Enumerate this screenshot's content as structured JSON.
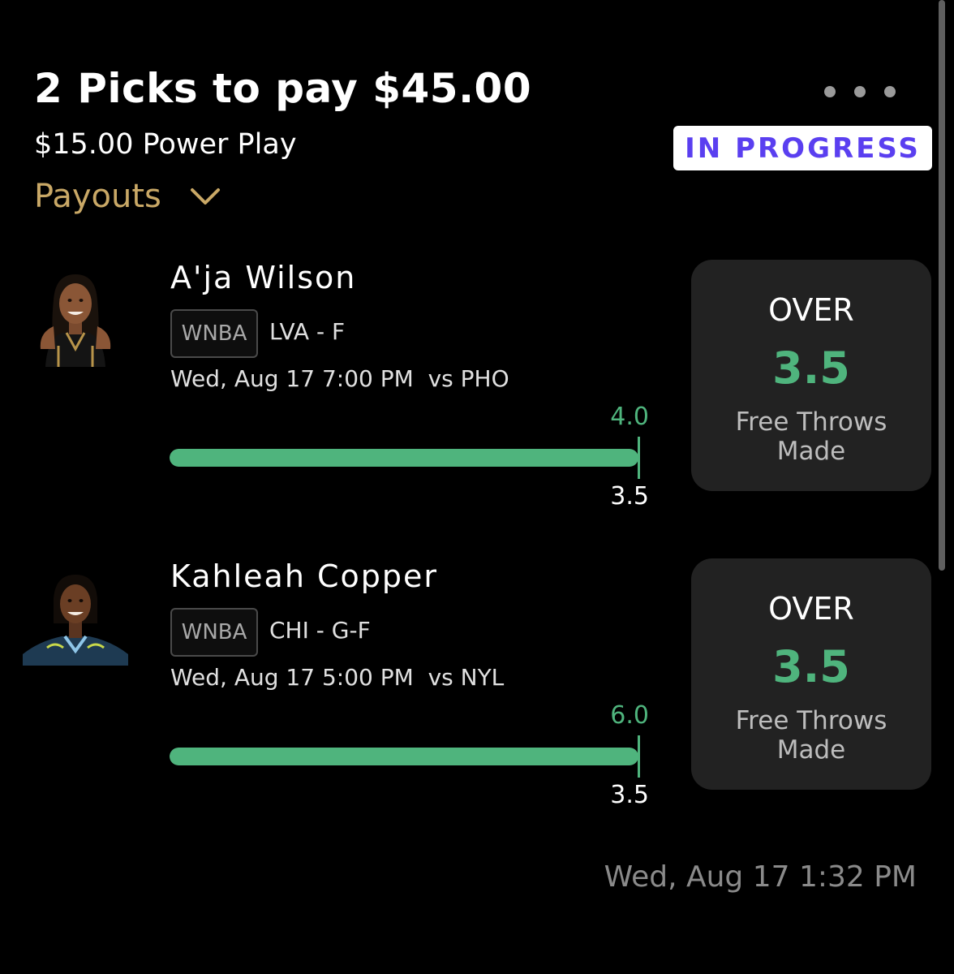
{
  "header": {
    "title": "2 Picks to pay $45.00",
    "subtitle": "$15.00 Power Play",
    "status": "IN PROGRESS",
    "payouts_label": "Payouts"
  },
  "picks": [
    {
      "player_name": "A'ja Wilson",
      "league": "WNBA",
      "team_position": "LVA - F",
      "game_time": "Wed, Aug 17 7:00 PM  vs PHO",
      "current_value": "4.0",
      "line_value": "3.5",
      "progress_fraction": 1.0,
      "direction": "OVER",
      "line": "3.5",
      "stat": "Free Throws Made"
    },
    {
      "player_name": "Kahleah Copper",
      "league": "WNBA",
      "team_position": "CHI - G-F",
      "game_time": "Wed, Aug 17 5:00 PM  vs NYL",
      "current_value": "6.0",
      "line_value": "3.5",
      "progress_fraction": 1.0,
      "direction": "OVER",
      "line": "3.5",
      "stat": "Free Throws Made"
    }
  ],
  "footer": {
    "timestamp": "Wed, Aug 17 1:32 PM"
  },
  "colors": {
    "background": "#000000",
    "accent_green": "#4fb47d",
    "status_purple": "#5a3ff0",
    "payouts_gold": "#c9a866",
    "card_bg": "#222222"
  },
  "icons": {
    "more": "more-horizontal-icon",
    "payouts": "chevron-down-icon"
  }
}
